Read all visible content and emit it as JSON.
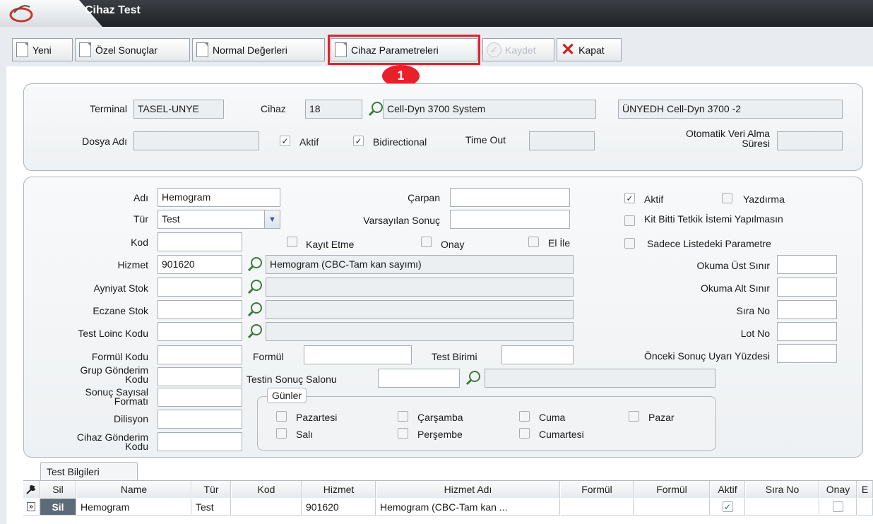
{
  "window": {
    "title": "Cihaz Test"
  },
  "toolbar": {
    "buttons": [
      "Yeni",
      "Özel Sonuçlar",
      "Normal Değerleri",
      "Cihaz Parametreleri",
      "Kaydet",
      "Kapat"
    ],
    "badge": "1",
    "highlight_color": "#e8202a"
  },
  "panel1": {
    "terminal_label": "Terminal",
    "terminal_value": "TASEL-UNYE",
    "cihaz_label": "Cihaz",
    "cihaz_value": "18",
    "cihaz_name": "Cell-Dyn 3700 System",
    "cihaz_desc": "ÜNYEDH Cell-Dyn 3700 -2",
    "dosya_label": "Dosya Adı",
    "dosya_value": "",
    "aktif_label": "Aktif",
    "aktif_checked": true,
    "bidi_label": "Bidirectional",
    "bidi_checked": true,
    "timeout_label": "Time Out",
    "timeout_value": "",
    "oto_label_1": "Otomatik Veri Alma",
    "oto_label_2": "Süresi",
    "oto_value": ""
  },
  "panel2": {
    "adi_label": "Adı",
    "adi_value": "Hemogram",
    "tur_label": "Tür",
    "tur_value": "Test",
    "kod_label": "Kod",
    "kod_value": "",
    "hizmet_label": "Hizmet",
    "hizmet_value": "901620",
    "hizmet_name": "Hemogram (CBC-Tam kan sayımı)",
    "ayniyat_label": "Ayniyat Stok",
    "eczane_label": "Eczane Stok",
    "loinc_label": "Test Loinc Kodu",
    "formul_kodu_label": "Formül Kodu",
    "formul_label": "Formül",
    "test_birimi_label": "Test Birimi",
    "grup_label_1": "Grup Gönderim",
    "grup_label_2": "Kodu",
    "sonuc_label_1": "Sonuç Sayısal",
    "sonuc_label_2": "Formatı",
    "dilisyon_label": "Dilisyon",
    "cihaz_gon_label_1": "Cihaz Gönderim",
    "cihaz_gon_label_2": "Kodu",
    "carpan_label": "Çarpan",
    "varsayilan_label": "Varsayılan Sonuç",
    "kayit_etme_label": "Kayıt Etme",
    "onay_label": "Onay",
    "el_ile_label": "El İle",
    "testin_salon_label": "Testin Sonuç Salonu",
    "aktif_label": "Aktif",
    "aktif_checked": true,
    "yazdirma_label": "Yazdırma",
    "kit_label": "Kit Bitti Tetkik İstemi Yapılmasın",
    "sadece_label": "Sadece Listedeki Parametre",
    "okuma_ust_label": "Okuma Üst Sınır",
    "okuma_alt_label": "Okuma Alt Sınır",
    "sira_no_label": "Sıra No",
    "lot_no_label": "Lot No",
    "onceki_label": "Önceki Sonuç Uyarı Yüzdesi",
    "gunler_title": "Günler",
    "days": [
      "Pazartesi",
      "Çarşamba",
      "Cuma",
      "Pazar",
      "Salı",
      "Perşembe",
      "Cumartesi"
    ]
  },
  "grid": {
    "tab": "Test Bilgileri",
    "headers": [
      "Sil",
      "Name",
      "Tür",
      "Kod",
      "Hizmet",
      "Hizmet Adı",
      "Formül",
      "Formül",
      "Aktif",
      "Sıra No",
      "Onay",
      "E"
    ],
    "row": {
      "sil": "Sil",
      "name": "Hemogram",
      "tur": "Test",
      "kod": "",
      "hizmet": "901620",
      "hizmet_adi": "Hemogram (CBC-Tam kan ...",
      "aktif_checked": true,
      "onay_checked": false
    }
  }
}
